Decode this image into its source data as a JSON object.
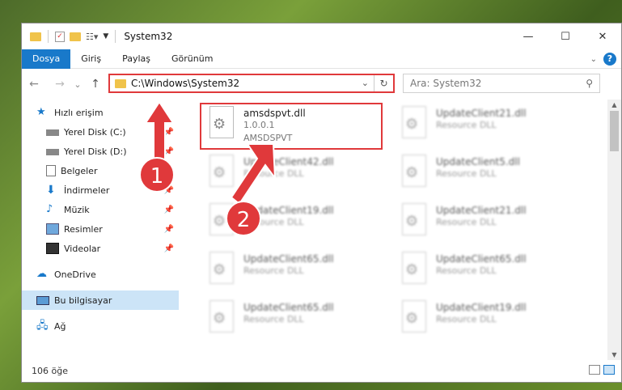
{
  "window": {
    "title": "System32",
    "controls": {
      "minimize": "—",
      "maximize": "☐",
      "close": "✕"
    }
  },
  "ribbon": {
    "tabs": [
      "Dosya",
      "Giriş",
      "Paylaş",
      "Görünüm"
    ],
    "active_tab": "Dosya",
    "help": "?"
  },
  "navigation": {
    "back": "←",
    "forward": "→",
    "recent": "⌄",
    "up": "↑",
    "address": "C:\\Windows\\System32",
    "refresh": "↻",
    "search_placeholder": "Ara: System32"
  },
  "sidebar": {
    "items": [
      {
        "label": "Hızlı erişim",
        "icon": "star-icon",
        "pinned": false,
        "top": true
      },
      {
        "label": "Yerel Disk (C:)",
        "icon": "drive-icon",
        "pinned": true
      },
      {
        "label": "Yerel Disk (D:)",
        "icon": "drive-icon",
        "pinned": true
      },
      {
        "label": "Belgeler",
        "icon": "documents-icon",
        "pinned": true
      },
      {
        "label": "İndirmeler",
        "icon": "download-icon",
        "pinned": true
      },
      {
        "label": "Müzik",
        "icon": "music-icon",
        "pinned": true
      },
      {
        "label": "Resimler",
        "icon": "pictures-icon",
        "pinned": true
      },
      {
        "label": "Videolar",
        "icon": "video-icon",
        "pinned": true
      },
      {
        "label": "OneDrive",
        "icon": "cloud-icon",
        "pinned": false,
        "top": true
      },
      {
        "label": "Bu bilgisayar",
        "icon": "computer-icon",
        "pinned": false,
        "top": true,
        "selected": true
      },
      {
        "label": "Ağ",
        "icon": "network-icon",
        "pinned": false,
        "top": true
      }
    ]
  },
  "files": {
    "main": {
      "name": "amsdspvt.dll",
      "version": "1.0.0.1",
      "company": "AMSDSPVT"
    },
    "others": [
      {
        "name": "UpdateClient21.dll",
        "type": "Resource DLL"
      },
      {
        "name": "UpdateClient42.dll",
        "type": "Resource DLL"
      },
      {
        "name": "UpdateClient5.dll",
        "type": "Resource DLL"
      },
      {
        "name": "UpdateClient19.dll",
        "type": "Resource DLL"
      },
      {
        "name": "UpdateClient21.dll",
        "type": "Resource DLL"
      },
      {
        "name": "UpdateClient65.dll",
        "type": "Resource DLL"
      },
      {
        "name": "UpdateClient65.dll",
        "type": "Resource DLL"
      },
      {
        "name": "UpdateClient65.dll",
        "type": "Resource DLL"
      },
      {
        "name": "UpdateClient19.dll",
        "type": "Resource DLL"
      }
    ]
  },
  "status": {
    "count": "106 öğe"
  },
  "annotations": {
    "step1": "1",
    "step2": "2",
    "color": "#e0393b"
  }
}
